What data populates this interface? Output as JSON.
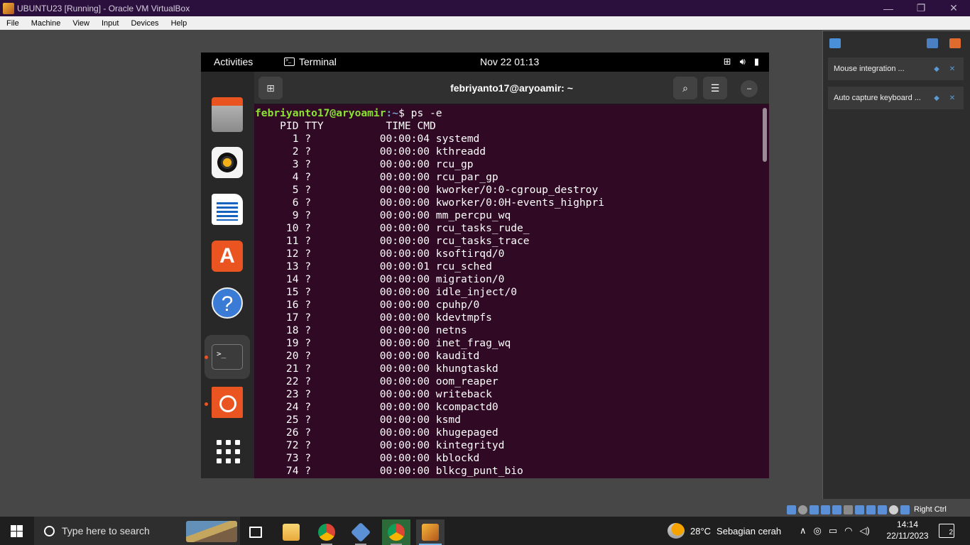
{
  "vbox": {
    "title": "UBUNTU23 [Running] - Oracle VM VirtualBox",
    "menu": [
      "File",
      "Machine",
      "View",
      "Input",
      "Devices",
      "Help"
    ],
    "window_buttons": {
      "minimize": "—",
      "restore": "❐",
      "close": "✕"
    },
    "host_key": "Right Ctrl",
    "notifications": [
      {
        "text": "Mouse integration ..."
      },
      {
        "text": "Auto capture keyboard ..."
      }
    ]
  },
  "gnome": {
    "activities": "Activities",
    "app_name": "Terminal",
    "clock": "Nov 22  01:13"
  },
  "terminal": {
    "title": "febriyanto17@aryoamir: ~",
    "prompt_user": "febriyanto17@aryoamir",
    "prompt_path": ":~",
    "command": "$ ps -e",
    "header": "    PID TTY          TIME CMD",
    "processes": [
      {
        "pid": "1",
        "tty": "?",
        "time": "00:00:04",
        "cmd": "systemd"
      },
      {
        "pid": "2",
        "tty": "?",
        "time": "00:00:00",
        "cmd": "kthreadd"
      },
      {
        "pid": "3",
        "tty": "?",
        "time": "00:00:00",
        "cmd": "rcu_gp"
      },
      {
        "pid": "4",
        "tty": "?",
        "time": "00:00:00",
        "cmd": "rcu_par_gp"
      },
      {
        "pid": "5",
        "tty": "?",
        "time": "00:00:00",
        "cmd": "kworker/0:0-cgroup_destroy"
      },
      {
        "pid": "6",
        "tty": "?",
        "time": "00:00:00",
        "cmd": "kworker/0:0H-events_highpri"
      },
      {
        "pid": "9",
        "tty": "?",
        "time": "00:00:00",
        "cmd": "mm_percpu_wq"
      },
      {
        "pid": "10",
        "tty": "?",
        "time": "00:00:00",
        "cmd": "rcu_tasks_rude_"
      },
      {
        "pid": "11",
        "tty": "?",
        "time": "00:00:00",
        "cmd": "rcu_tasks_trace"
      },
      {
        "pid": "12",
        "tty": "?",
        "time": "00:00:00",
        "cmd": "ksoftirqd/0"
      },
      {
        "pid": "13",
        "tty": "?",
        "time": "00:00:01",
        "cmd": "rcu_sched"
      },
      {
        "pid": "14",
        "tty": "?",
        "time": "00:00:00",
        "cmd": "migration/0"
      },
      {
        "pid": "15",
        "tty": "?",
        "time": "00:00:00",
        "cmd": "idle_inject/0"
      },
      {
        "pid": "16",
        "tty": "?",
        "time": "00:00:00",
        "cmd": "cpuhp/0"
      },
      {
        "pid": "17",
        "tty": "?",
        "time": "00:00:00",
        "cmd": "kdevtmpfs"
      },
      {
        "pid": "18",
        "tty": "?",
        "time": "00:00:00",
        "cmd": "netns"
      },
      {
        "pid": "19",
        "tty": "?",
        "time": "00:00:00",
        "cmd": "inet_frag_wq"
      },
      {
        "pid": "20",
        "tty": "?",
        "time": "00:00:00",
        "cmd": "kauditd"
      },
      {
        "pid": "21",
        "tty": "?",
        "time": "00:00:00",
        "cmd": "khungtaskd"
      },
      {
        "pid": "22",
        "tty": "?",
        "time": "00:00:00",
        "cmd": "oom_reaper"
      },
      {
        "pid": "23",
        "tty": "?",
        "time": "00:00:00",
        "cmd": "writeback"
      },
      {
        "pid": "24",
        "tty": "?",
        "time": "00:00:00",
        "cmd": "kcompactd0"
      },
      {
        "pid": "25",
        "tty": "?",
        "time": "00:00:00",
        "cmd": "ksmd"
      },
      {
        "pid": "26",
        "tty": "?",
        "time": "00:00:00",
        "cmd": "khugepaged"
      },
      {
        "pid": "72",
        "tty": "?",
        "time": "00:00:00",
        "cmd": "kintegrityd"
      },
      {
        "pid": "73",
        "tty": "?",
        "time": "00:00:00",
        "cmd": "kblockd"
      },
      {
        "pid": "74",
        "tty": "?",
        "time": "00:00:00",
        "cmd": "blkcg_punt_bio"
      }
    ]
  },
  "taskbar": {
    "search_placeholder": "Type here to search",
    "weather_temp": "28°C",
    "weather_desc": "Sebagian cerah",
    "time": "14:14",
    "date": "22/11/2023",
    "notification_count": "2"
  },
  "colors": {
    "terminal_bg": "#300a24",
    "prompt_user": "#8ae234",
    "prompt_path": "#729fcf",
    "ubuntu_orange": "#e95420"
  }
}
